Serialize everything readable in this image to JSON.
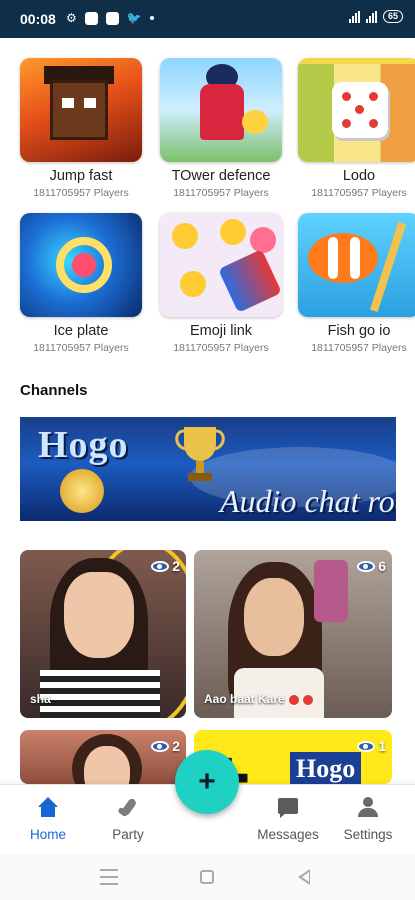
{
  "status_bar": {
    "time": "00:08",
    "battery": "65"
  },
  "games": [
    {
      "title": "Jump fast",
      "players": "1811705957 Players",
      "art": "jump"
    },
    {
      "title": "TOwer defence",
      "players": "1811705957 Players",
      "art": "tower"
    },
    {
      "title": "Lodo",
      "players": "1811705957 Players",
      "art": "lodo"
    },
    {
      "title": "Ice plate",
      "players": "1811705957 Players",
      "art": "ice"
    },
    {
      "title": "Emoji link",
      "players": "1811705957 Players",
      "art": "emoji"
    },
    {
      "title": "Fish go io",
      "players": "1811705957 Players",
      "art": "fish"
    }
  ],
  "channels": {
    "title": "Channels",
    "banner": {
      "brand": "Hogo",
      "tagline": "Audio chat room"
    }
  },
  "rooms": [
    {
      "name": "sha",
      "viewers": "2"
    },
    {
      "name": "Aao baat Kare",
      "viewers": "6"
    },
    {
      "name": "",
      "viewers": "2"
    },
    {
      "name": "",
      "viewers": "1",
      "brand": "Hogo"
    }
  ],
  "fab": {
    "label": "+"
  },
  "bottom_nav": {
    "items": [
      {
        "label": "Home",
        "icon": "home-icon",
        "active": true
      },
      {
        "label": "Party",
        "icon": "party-icon",
        "active": false
      },
      {
        "label": "Messages",
        "icon": "messages-icon",
        "active": false
      },
      {
        "label": "Settings",
        "icon": "settings-icon",
        "active": false
      }
    ]
  },
  "colors": {
    "status_bar": "#0e2f47",
    "accent": "#1967d2",
    "fab": "#1fd1c2"
  }
}
